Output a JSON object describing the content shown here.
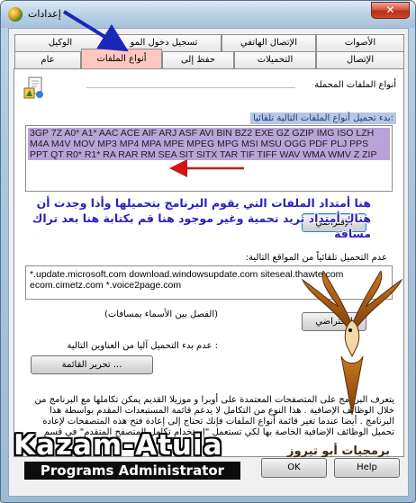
{
  "window": {
    "title": "إعدادات",
    "close_glyph": "✕"
  },
  "tabs_top": [
    {
      "label": "الأصوات"
    },
    {
      "label": "الإتصال الهاتفي"
    },
    {
      "label": "تسجيل دخول المو"
    },
    {
      "label": "الوكيل"
    }
  ],
  "tabs_bottom": [
    {
      "label": "الإتصال"
    },
    {
      "label": "التحميلات"
    },
    {
      "label": "حفظ إلى"
    },
    {
      "label": "أنواع الملفات"
    },
    {
      "label": "عام"
    }
  ],
  "panel": {
    "section_title": "أنواع الملفات المحملة",
    "auto_download_label": "بدء تحميل أنواع الملفات التالية تلقائيا:",
    "extensions": "3GP 7Z A0* A1* AAC ACE AIF ARJ ASF AVI BIN BZ2 EXE GZ GZIP IMG ISO LZH M4A M4V MOV MP3 MP4 MPA MPE MPEG MPG MSI MSU OGG PDF PLJ PPS PPT QT R0* R1* RA RAR RM SEA SIT SITX TAR TIF TIFF WAV WMA WMV Z ZIP",
    "default_button": "الإفتراضي",
    "overlay_note": "هنا أمتداد الملفات التي يقوم البرنامج بتحميلها وأذا وجدت أن هناك أمتداد تريد تحمية وغير موجود هنا قم بكتابة هنا بعد تراك مسافة",
    "sites_label": "عدم التحميل تلقائياً من المواقع التالية:",
    "sites": "*.update.microsoft.com download.windowsupdate.com siteseal.thawte.com ecom.cimetz.com *.voice2page.com",
    "separator_hint": "(الفصل بين الأسماء بمسافات)",
    "default_button_2": "الإفتراضي",
    "no_start_label": ": عدم بدء التحميل آليا من العناوين التالية",
    "edit_list_button": "تحرير القائمة ...",
    "footer_text": "يتعرف البرنامج على المتصفحات المعتمدة على أوبرا و موزيلا القديم يمكن تكاملها مع البرنامج من خلال الوظائف الإضافية . هذا النوع من التكامل لا يدعم قائمة المستبعدات المقدم بواسطة هذا البرنامج . أيضا عندما تغير قائمة أنواع الملفات فإنك تحتاج إلى إعادة فتح هذه المتصفحات لإعادة تحميل الوظائف الإضافية الخاصة بها لكي تستعمل \"إستخدام تكامل المتصفح المتقدم\" في قسم"
  },
  "buttons": {
    "ok": "OK",
    "help": "Help"
  },
  "branding": {
    "logo": "Kazam-Atuia",
    "subtitle": "Programs Administrator",
    "signature": "برمجيات أبو تيروز"
  },
  "colors": {
    "active_tab": "#ffc7c0",
    "extension_highlight": "#b9a3d8",
    "annotation_text": "#2a1fbf",
    "arrow_blue": "#1a27b8",
    "arrow_red": "#d11414"
  },
  "icons": [
    "app-icon",
    "document-settings-icon",
    "eagle-emblem-icon",
    "arrow-icon"
  ]
}
